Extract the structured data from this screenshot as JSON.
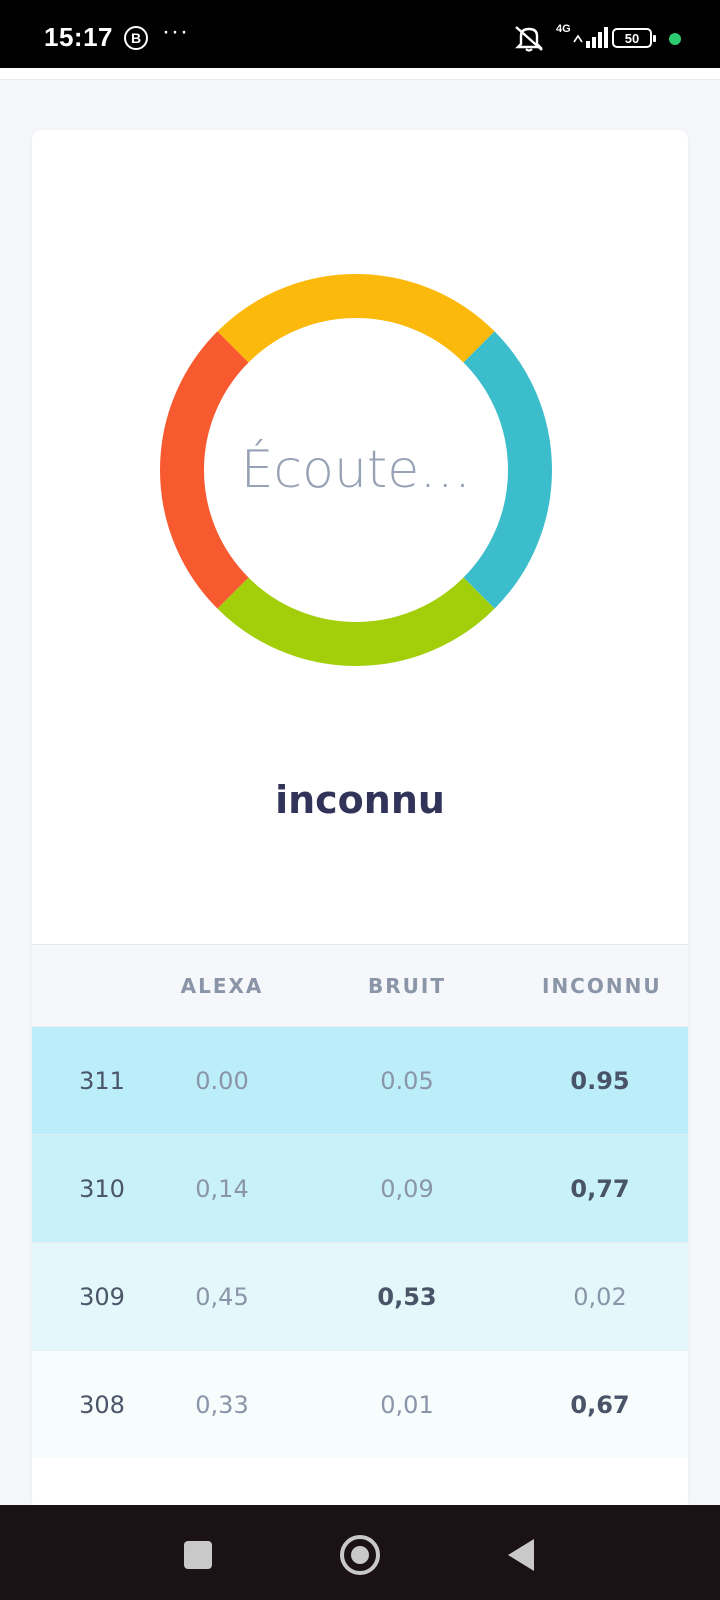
{
  "status_bar": {
    "time": "15:17",
    "b_badge": "B",
    "dots": "···",
    "network": "4G",
    "battery": "50",
    "icons": [
      "b-badge-icon",
      "more-dots-icon",
      "mute-bell-icon",
      "signal-icon",
      "battery-icon"
    ]
  },
  "ring": {
    "text": "Écoute…",
    "segments": [
      {
        "name": "yellow",
        "color": "#FBB90B",
        "from": -45,
        "to": 45
      },
      {
        "name": "teal",
        "color": "#3BBDCB",
        "from": 45,
        "to": 135
      },
      {
        "name": "green",
        "color": "#A3CE0A",
        "from": 135,
        "to": 225
      },
      {
        "name": "red",
        "color": "#F85A30",
        "from": 225,
        "to": 315
      }
    ]
  },
  "result": {
    "label": "inconnu"
  },
  "table": {
    "headers": [
      "",
      "ALEXA",
      "BRUIT",
      "INCONNU"
    ],
    "rows": [
      {
        "id": "311",
        "alexa": "0.00",
        "bruit": "0.05",
        "inconnu": "0.95",
        "bold": 3,
        "color": "#BCEEFA"
      },
      {
        "id": "310",
        "alexa": "0,14",
        "bruit": "0,09",
        "inconnu": "0,77",
        "bold": 3,
        "color": "#C9F1FA"
      },
      {
        "id": "309",
        "alexa": "0,45",
        "bruit": "0,53",
        "inconnu": "0,02",
        "bold": 2,
        "color": "#E4F7FB"
      },
      {
        "id": "308",
        "alexa": "0,33",
        "bruit": "0,01",
        "inconnu": "0,67",
        "bold": 3,
        "color": "#F7FCFD"
      }
    ]
  },
  "nav": {
    "icons": [
      "recent-apps-icon",
      "home-icon",
      "back-icon"
    ]
  }
}
